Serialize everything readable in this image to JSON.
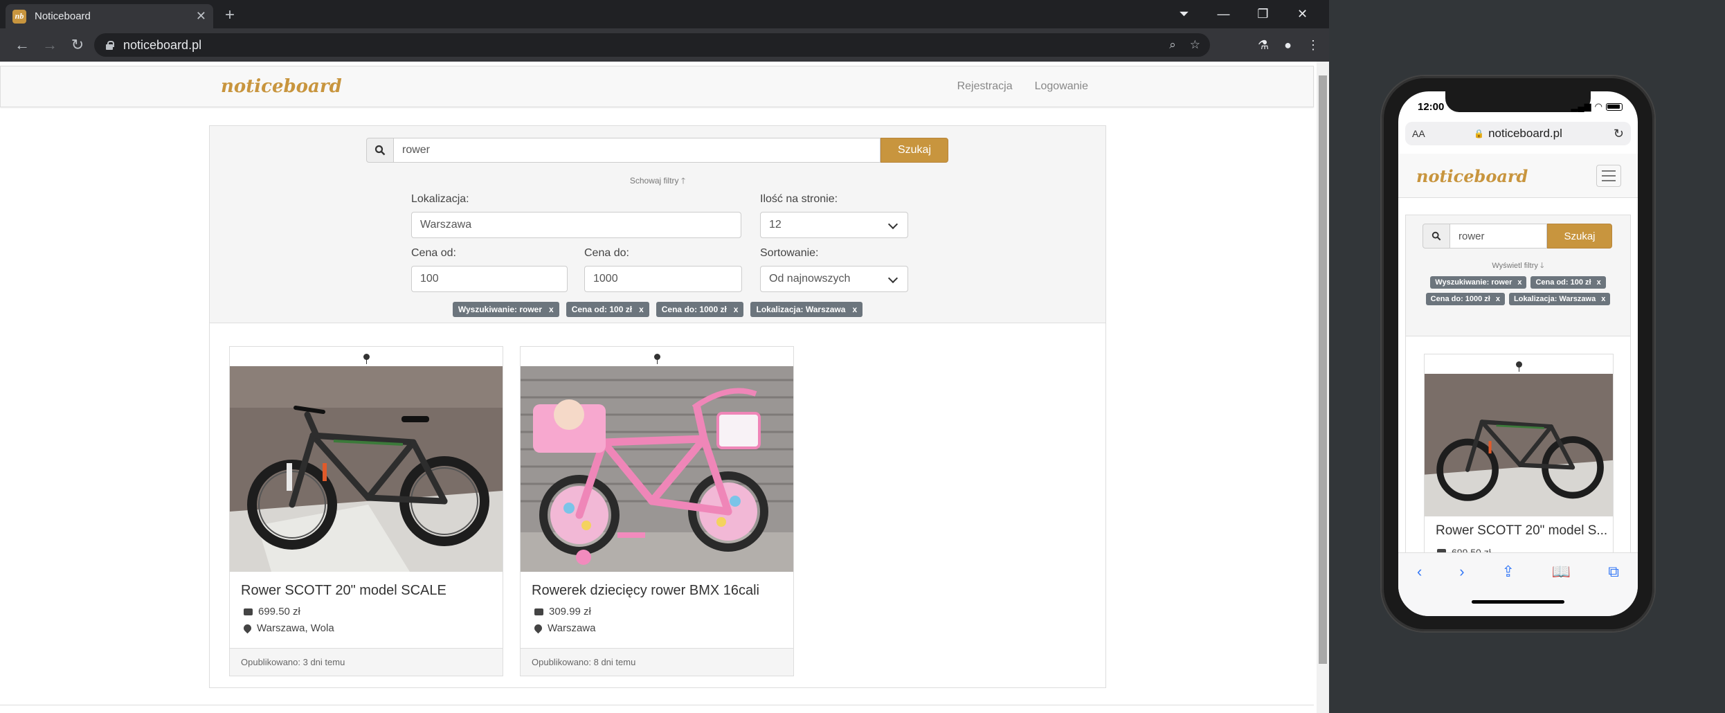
{
  "browser": {
    "tab_title": "Noticeboard",
    "favicon_text": "nb",
    "url": "noticeboard.pl"
  },
  "site": {
    "brand": "noticeboard",
    "nav": [
      "Rejestracja",
      "Logowanie"
    ]
  },
  "search": {
    "query": "rower",
    "button": "Szukaj",
    "hide_filters": "Schowaj filtry",
    "show_filters": "Wyświetl filtry"
  },
  "filters": {
    "location_label": "Lokalizacja:",
    "location_value": "Warszawa",
    "per_page_label": "Ilość na stronie:",
    "per_page_value": "12",
    "price_from_label": "Cena od:",
    "price_from_value": "100",
    "price_to_label": "Cena do:",
    "price_to_value": "1000",
    "sort_label": "Sortowanie:",
    "sort_value": "Od najnowszych"
  },
  "chips": [
    {
      "label": "Wyszukiwanie: rower",
      "close": "x"
    },
    {
      "label": "Cena od: 100 zł",
      "close": "x"
    },
    {
      "label": "Cena do: 1000 zł",
      "close": "x"
    },
    {
      "label": "Lokalizacja: Warszawa",
      "close": "x"
    }
  ],
  "listings": [
    {
      "title": "Rower SCOTT 20\" model SCALE",
      "price": "699.50 zł",
      "location": "Warszawa, Wola",
      "published": "Opublikowano: 3 dni temu"
    },
    {
      "title": "Rowerek dziecięcy rower BMX 16cali",
      "price": "309.99 zł",
      "location": "Warszawa",
      "published": "Opublikowano: 8 dni temu"
    }
  ],
  "phone": {
    "time": "12:00",
    "aa": "AA",
    "url": "noticeboard.pl",
    "card_title": "Rower SCOTT 20\" model S...",
    "card_price": "699.50 zł"
  },
  "colors": {
    "brand": "#c8953e",
    "chip": "#6c757d"
  }
}
